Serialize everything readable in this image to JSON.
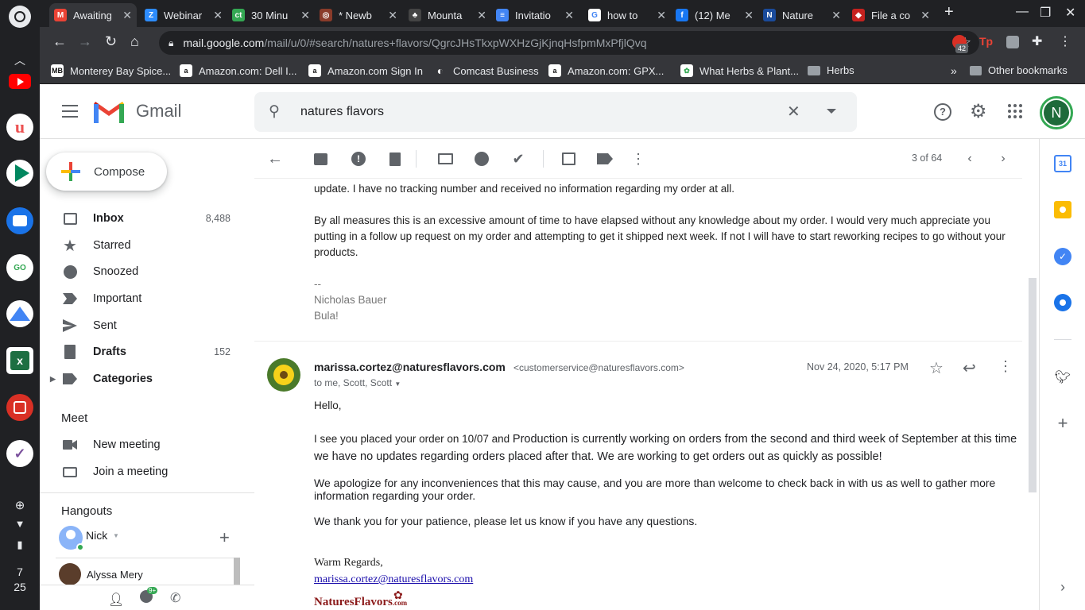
{
  "shelf": {
    "clock_hour": "7",
    "clock_min": "25",
    "apps": [
      "launcher-icon",
      "youtube-icon",
      "udemy-icon",
      "play-store-icon",
      "messages-icon",
      "go-icon",
      "google-home-icon",
      "excel-icon",
      "screenshot-icon",
      "viber-icon"
    ]
  },
  "tabs": [
    {
      "title": "Awaiting",
      "color": "#ea4335",
      "glyph": "M"
    },
    {
      "title": "Webinar",
      "color": "#2d8cff",
      "glyph": "Z"
    },
    {
      "title": "30 Minu",
      "color": "#34a853",
      "glyph": "ct"
    },
    {
      "title": "* Newb",
      "color": "#8a3b2a",
      "glyph": "◎"
    },
    {
      "title": "Mounta",
      "color": "#444",
      "glyph": "♣"
    },
    {
      "title": "Invitatio",
      "color": "#4285f4",
      "glyph": "≡"
    },
    {
      "title": "how to",
      "color": "#fff",
      "glyph": "G"
    },
    {
      "title": "(12) Me",
      "color": "#1877f2",
      "glyph": "f"
    },
    {
      "title": "Nature",
      "color": "#1a4b9b",
      "glyph": "N"
    },
    {
      "title": "File a co",
      "color": "#c5221f",
      "glyph": "◆"
    }
  ],
  "toolbar": {
    "url_host": "mail.google.com",
    "url_path": "/mail/u/0/#search/natures+flavors/QgrcJHsTkxpWXHzGjKjnqHsfpmMxPfjlQvq",
    "badge": "42"
  },
  "bookmarks": [
    {
      "label": "Monterey Bay Spice...",
      "icon": "MB"
    },
    {
      "label": "Amazon.com: Dell I...",
      "icon": "a"
    },
    {
      "label": "Amazon.com Sign In",
      "icon": "a"
    },
    {
      "label": "Comcast Business",
      "icon": "◐"
    },
    {
      "label": "Amazon.com: GPX...",
      "icon": "a"
    },
    {
      "label": "What Herbs & Plant...",
      "icon": "✿"
    },
    {
      "label": "Herbs",
      "icon": "folder"
    }
  ],
  "bookmarks_more": "»",
  "other_bookmarks": "Other bookmarks",
  "gmail": {
    "logo_text": "Gmail",
    "search_value": "natures flavors",
    "avatar_letter": "N"
  },
  "nav": {
    "compose": "Compose",
    "items": [
      {
        "label": "Inbox",
        "count": "8,488",
        "bold": true
      },
      {
        "label": "Starred",
        "count": ""
      },
      {
        "label": "Snoozed",
        "count": ""
      },
      {
        "label": "Important",
        "count": ""
      },
      {
        "label": "Sent",
        "count": ""
      },
      {
        "label": "Drafts",
        "count": "152",
        "bold": true
      },
      {
        "label": "Categories",
        "count": "",
        "bold": true
      }
    ],
    "meet_title": "Meet",
    "meet_new": "New meeting",
    "meet_join": "Join a meeting",
    "hangouts_title": "Hangouts",
    "hangouts_user": "Nick",
    "contact": "Alyssa Mery"
  },
  "pager": "3 of 64",
  "email1": {
    "line0": "update. I have no tracking number and received no information regarding my order at all.",
    "para1": "By all measures this is an excessive amount of time to have elapsed without any knowledge about my order. I would very much appreciate you putting in a follow up request on my order and attempting to get it shipped next week. If not I will have to start reworking recipes to go without your products.",
    "sig_dash": "--",
    "sig_name": "Nicholas Bauer",
    "sig_extra": "Bula!"
  },
  "email2": {
    "sender": "marissa.cortez@naturesflavors.com",
    "sender_email": "<customerservice@naturesflavors.com>",
    "to": "to me, Scott, Scott",
    "date": "Nov 24, 2020, 5:17 PM",
    "greeting": "Hello,",
    "p1a": "I see you placed your order on 10/07 and ",
    "p1b": "Production is currently working on orders from the second and third week of September at this time we have no updates regarding orders placed after that. We are working to get orders out as quickly as possible!",
    "p2": "We apologize for any inconveniences that this may cause, and you are more than welcome to check back in with us as well to gather more information regarding your order.",
    "p3": "We thank you for your patience, please let us know if you have any questions.",
    "closing": "Warm Regards,",
    "link": "marissa.cortez@naturesflavors.com",
    "logo_text": "NaturesFlavors",
    "logo_suffix": ".com"
  }
}
